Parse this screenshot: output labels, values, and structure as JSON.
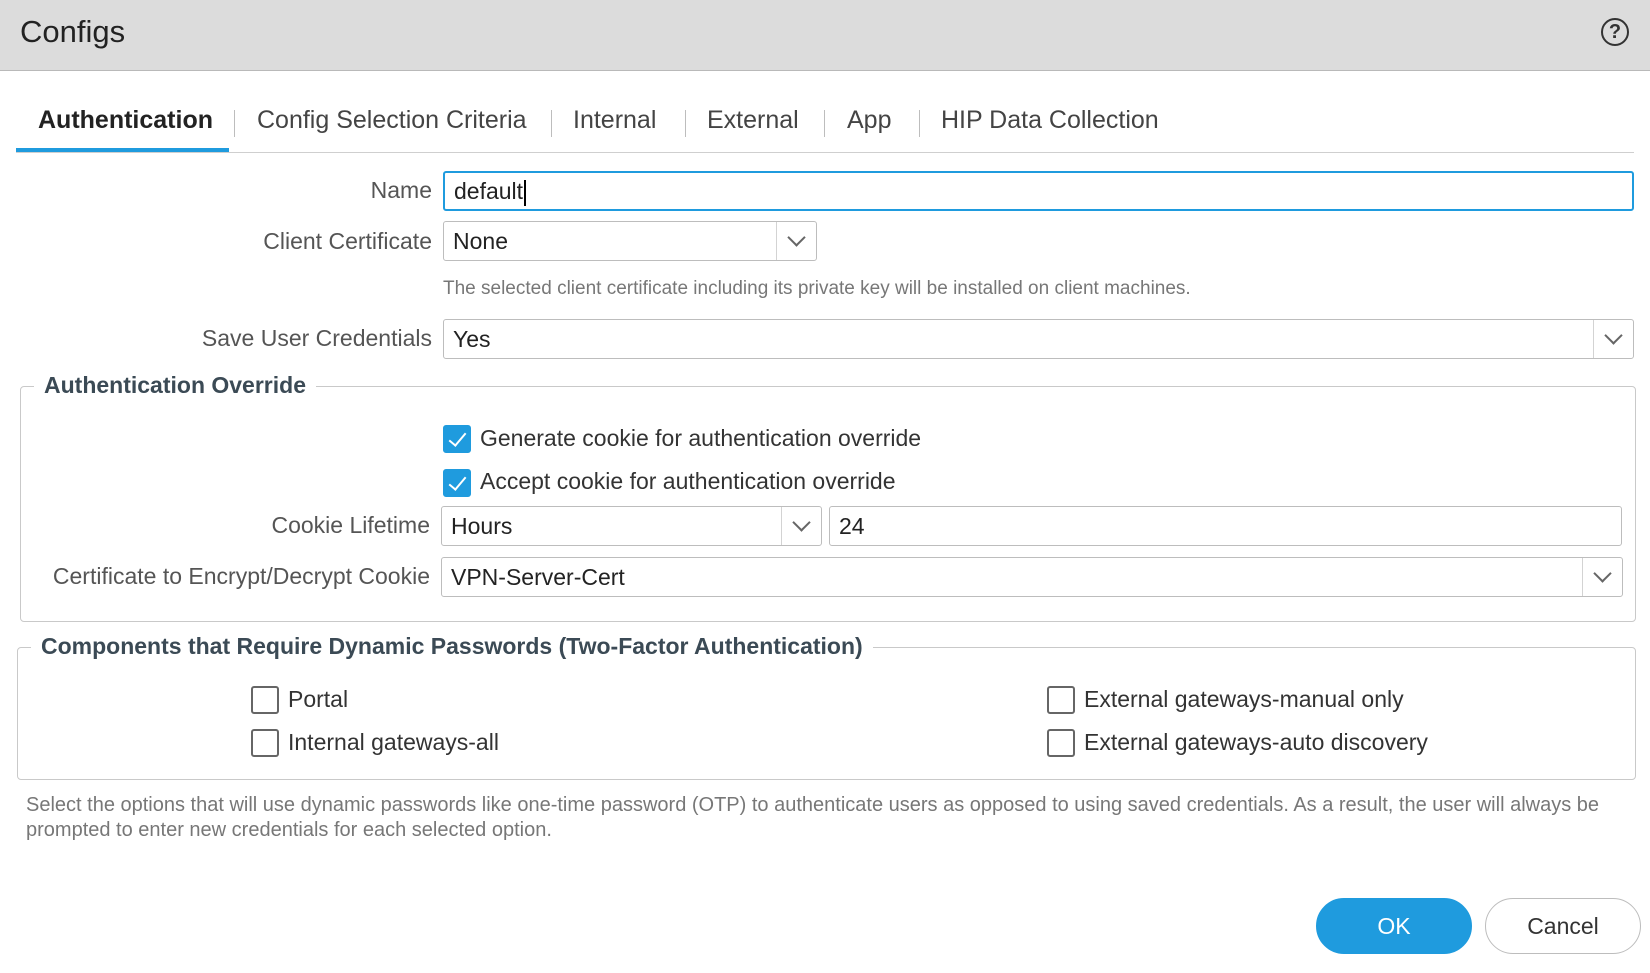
{
  "dialog": {
    "title": "Configs",
    "help_icon": "question-circle-icon"
  },
  "tabs": [
    {
      "label": "Authentication",
      "active": true
    },
    {
      "label": "Config Selection Criteria"
    },
    {
      "label": "Internal"
    },
    {
      "label": "External"
    },
    {
      "label": "App"
    },
    {
      "label": "HIP Data Collection"
    }
  ],
  "form": {
    "name_label": "Name",
    "name_value": "default",
    "client_cert_label": "Client Certificate",
    "client_cert_value": "None",
    "client_cert_hint": "The selected client certificate including its private key will be installed on client machines.",
    "save_creds_label": "Save User Credentials",
    "save_creds_value": "Yes"
  },
  "auth_override": {
    "legend": "Authentication Override",
    "generate_cookie_label": "Generate cookie for authentication override",
    "generate_cookie_checked": true,
    "accept_cookie_label": "Accept cookie for authentication override",
    "accept_cookie_checked": true,
    "cookie_lifetime_label": "Cookie Lifetime",
    "cookie_lifetime_unit": "Hours",
    "cookie_lifetime_value": "24",
    "cert_label": "Certificate to Encrypt/Decrypt Cookie",
    "cert_value": "VPN-Server-Cert"
  },
  "dynamic_passwords": {
    "legend": "Components that Require Dynamic Passwords (Two-Factor Authentication)",
    "portal_label": "Portal",
    "internal_all_label": "Internal gateways-all",
    "external_manual_label": "External gateways-manual only",
    "external_auto_label": "External gateways-auto discovery",
    "footnote": "Select the options that will use dynamic passwords like one-time password (OTP) to authenticate users as opposed to using saved credentials. As a result, the user will always be prompted to enter new credentials for each selected option."
  },
  "buttons": {
    "ok": "OK",
    "cancel": "Cancel"
  },
  "colors": {
    "accent": "#1f9bde",
    "header_bg": "#dcdcdc"
  }
}
